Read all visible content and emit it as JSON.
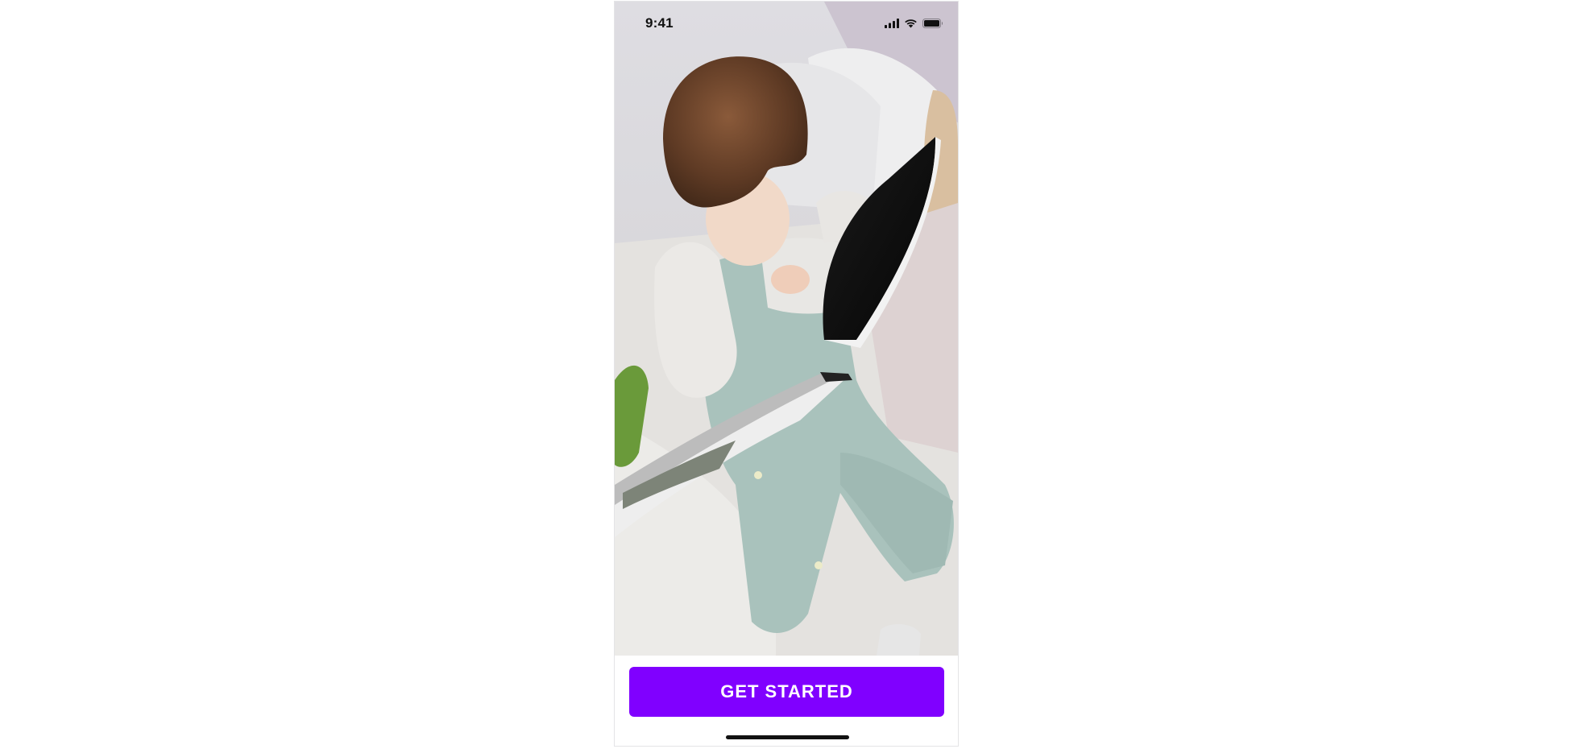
{
  "status_bar": {
    "time": "9:41",
    "icons": [
      "cellular-signal-icon",
      "wifi-icon",
      "battery-icon"
    ]
  },
  "hero": {
    "image": "photo of a toddler reading a picture book on a bed"
  },
  "cta": {
    "label": "GET STARTED",
    "color": "#8000ff"
  }
}
